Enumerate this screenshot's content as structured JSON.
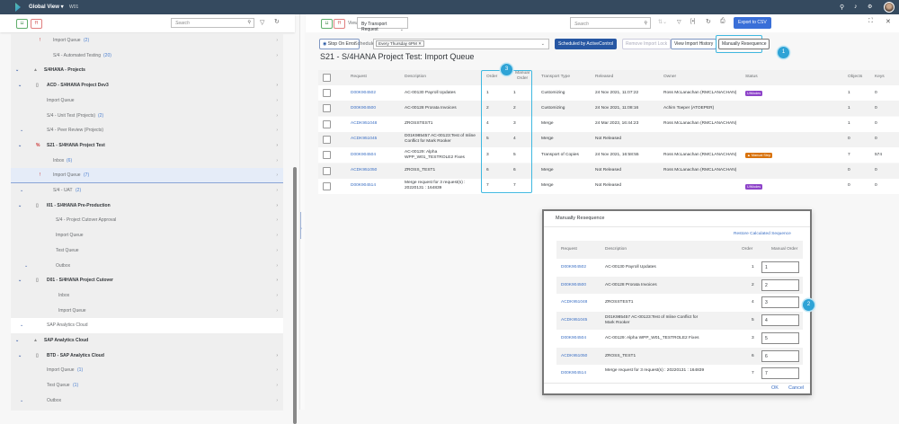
{
  "shell": {
    "title": "Global View",
    "subtitle": "W01",
    "icons": [
      "search-icon",
      "bell-icon",
      "settings-icon",
      "help-icon",
      "avatar"
    ]
  },
  "left": {
    "search_placeholder": "Search",
    "tree": [
      {
        "label": "Import Queue",
        "count": "(2)",
        "level": 3,
        "icon": "alert"
      },
      {
        "label": "S/4 - Automated Testing",
        "count": "(20)",
        "level": 3
      },
      {
        "label": "S/4HANA - Projects",
        "level": 0,
        "bold": true,
        "expanded": true,
        "icon": "group",
        "noarrow": true
      },
      {
        "label": "ACD - S/4HANA Project Dev3",
        "level": 1,
        "bold": true,
        "expanded": true,
        "icon": "system"
      },
      {
        "label": "Import Queue",
        "level": 2
      },
      {
        "label": "S/4 - Unit Test (Projects)",
        "count": "(2)",
        "level": 2
      },
      {
        "label": "S/4 - Peer Review (Projects)",
        "level": 2,
        "expanded": true
      },
      {
        "label": "S21 - S/4HANA Project Test",
        "level": 1,
        "bold": true,
        "expanded": true,
        "icon": "system-error"
      },
      {
        "label": "Inbox",
        "count": "(6)",
        "level": 3
      },
      {
        "label": "Import Queue",
        "count": "(7)",
        "level": 3,
        "selected": true,
        "icon": "alert"
      },
      {
        "label": "S/4 - UAT",
        "count": "(2)",
        "level": 3,
        "expanded": true
      },
      {
        "label": "I01 - S/4HANA Pre-Production",
        "level": 1,
        "bold": true,
        "expanded": true,
        "icon": "system"
      },
      {
        "label": "S/4 - Project Cutover Approval",
        "level": 4
      },
      {
        "label": "Import Queue",
        "level": 4
      },
      {
        "label": "Test Queue",
        "level": 4
      },
      {
        "label": "Outbox",
        "level": 4,
        "expanded": true
      },
      {
        "label": "D01 - S/4HANA Project Cutover",
        "level": 1,
        "bold": true,
        "expanded": true,
        "icon": "system"
      },
      {
        "label": "Inbox",
        "level": 5
      },
      {
        "label": "Import Queue",
        "level": 5
      },
      {
        "label": "SAP Analytics Cloud",
        "level": 2,
        "white": true,
        "expanded": true,
        "noarrow": true
      },
      {
        "label": "SAP Analytics Cloud",
        "level": 0,
        "bold": true,
        "expanded": true,
        "icon": "group",
        "noarrow": true
      },
      {
        "label": "BTD - SAP Analytics Cloud",
        "level": 1,
        "bold": true,
        "expanded": true,
        "icon": "system"
      },
      {
        "label": "Import Queue",
        "count": "(1)",
        "level": 2
      },
      {
        "label": "Test Queue",
        "count": "(1)",
        "level": 2
      },
      {
        "label": "Outbox",
        "level": 2,
        "expanded": true
      },
      {
        "label": "T01 - SAP Analytics Cloud - Production",
        "level": 1,
        "bold": true,
        "expanded": true,
        "icon": "system"
      }
    ]
  },
  "right": {
    "view_label": "View",
    "view_value": "By Transport Request",
    "search_placeholder": "Search",
    "export_label": "Export to CSV",
    "stop_on_error": "Stop On Error",
    "schedule_label": "Schedule:",
    "schedule_token": "Every Thursday 6PM",
    "scheduled_btn": "Scheduled by ActiveControl",
    "remove_lock": "Remove Import Lock",
    "view_history": "View Import History",
    "resequence": "Manually Resequence",
    "title": "S21 - S/4HANA Project Test: Import Queue",
    "callouts": [
      "1",
      "2",
      "3"
    ],
    "columns": [
      "Request",
      "Description",
      "Order",
      "Manual Order",
      "Transport Type",
      "Released",
      "Owner",
      "Status",
      "Objects",
      "Keys"
    ],
    "rows": [
      {
        "request": "D00K904502",
        "description": "AC-00130 Payroll Updates",
        "order": "1",
        "manual": "1",
        "type": "Customizing",
        "released": "24 Nov 2021, 11:07:22",
        "owner": "Ross McLanachan (RMCLANACHAN)",
        "status": "UIModes",
        "objects": "1",
        "keys": "0"
      },
      {
        "request": "D00K904500",
        "description": "AC-00128 Prorata Invoices",
        "order": "2",
        "manual": "2",
        "type": "Customizing",
        "released": "24 Nov 2021, 11:08:16",
        "owner": "Achim Toeper (ATOEPER)",
        "status": "",
        "objects": "1",
        "keys": "0"
      },
      {
        "request": "ACDK951048",
        "description": "ZROSSTEST1",
        "order": "4",
        "manual": "3",
        "type": "Merge",
        "released": "24 Mar 2023, 16:44:23",
        "owner": "Ross McLanachan (RMCLANACHAN)",
        "status": "",
        "objects": "1",
        "keys": "0"
      },
      {
        "request": "ACDK951045",
        "description": "D01K985457 AC-00123:Test of Inline Conflict for Mark Rooker",
        "order": "5",
        "manual": "4",
        "type": "Merge",
        "released": "Not Released",
        "owner": "",
        "status": "",
        "objects": "0",
        "keys": "0"
      },
      {
        "request": "D00K904504",
        "description": "AC-00129: Alpha WPP_W01_TESTROLE2 Fixes",
        "order": "3",
        "manual": "5",
        "type": "Transport of Copies",
        "released": "24 Nov 2021, 16:58:55",
        "owner": "Ross McLanachan (RMCLANACHAN)",
        "status": "Manual Step",
        "objects": "7",
        "keys": "574"
      },
      {
        "request": "ACDK951050",
        "description": "ZROSS_TEST1",
        "order": "6",
        "manual": "6",
        "type": "Merge",
        "released": "Not Released",
        "owner": "Ross McLanachan (RMCLANACHAN)",
        "status": "",
        "objects": "0",
        "keys": "0"
      },
      {
        "request": "D00K904514",
        "description": "Merge request for 3 request(s) : 20220131 : 164839",
        "order": "7",
        "manual": "7",
        "type": "Merge",
        "released": "Not Released",
        "owner": "",
        "status": "UIModes",
        "objects": "0",
        "keys": "0"
      }
    ],
    "status_colors": {
      "UIModes": "#8e44c9",
      "Manual Step": "#d9730d"
    }
  },
  "dialog": {
    "title": "Manually Resequence",
    "restore": "Restore Calculated Sequence",
    "columns": [
      "Request",
      "Description",
      "Order",
      "Manual Order"
    ],
    "ok": "OK",
    "cancel": "Cancel"
  }
}
